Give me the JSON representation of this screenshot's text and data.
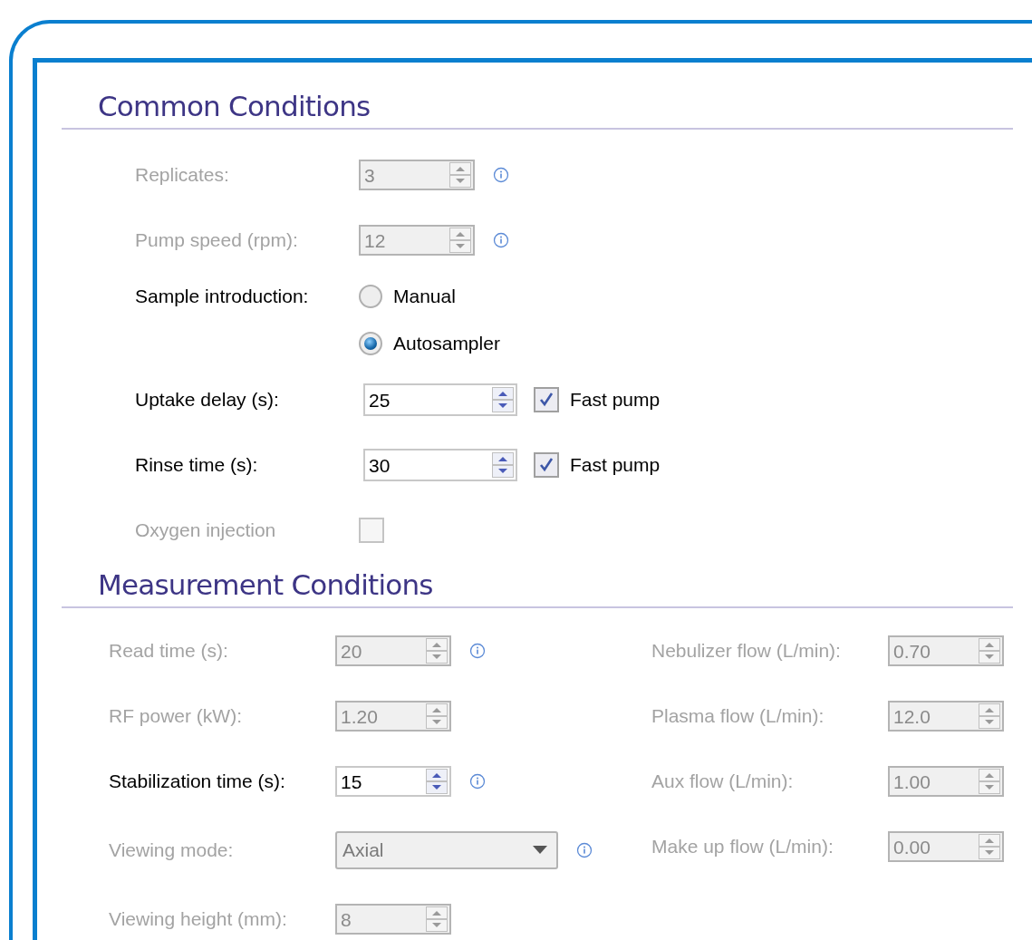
{
  "common": {
    "title": "Common Conditions",
    "rows": [
      {
        "kind": "spin",
        "label": "Replicates:",
        "value": "3",
        "disabled": true,
        "info": true
      },
      {
        "kind": "spin",
        "label": "Pump speed (rpm):",
        "value": "12",
        "disabled": true,
        "info": true
      },
      {
        "kind": "radio",
        "label": "Sample introduction:",
        "disabled": false,
        "options": [
          {
            "label": "Manual",
            "selected": false
          },
          {
            "label": "Autosampler",
            "selected": true
          }
        ]
      },
      {
        "kind": "spin",
        "label": "Uptake delay (s):",
        "value": "25",
        "disabled": false,
        "checkbox": {
          "label": "Fast pump",
          "checked": true
        }
      },
      {
        "kind": "spin",
        "label": "Rinse time (s):",
        "value": "30",
        "disabled": false,
        "checkbox": {
          "label": "Fast pump",
          "checked": true
        }
      },
      {
        "kind": "check",
        "label": "Oxygen injection",
        "disabled": true,
        "checked": false
      }
    ]
  },
  "measurement": {
    "title": "Measurement Conditions",
    "columns": [
      [
        {
          "kind": "spin",
          "label": "Read time (s):",
          "value": "20",
          "disabled": true,
          "info": true
        },
        {
          "kind": "spin",
          "label": "RF power (kW):",
          "value": "1.20",
          "disabled": true
        },
        {
          "kind": "spin",
          "label": "Stabilization time (s):",
          "value": "15",
          "disabled": false,
          "info": true
        },
        {
          "kind": "select",
          "label": "Viewing mode:",
          "value": "Axial",
          "disabled": true,
          "info": true
        },
        {
          "kind": "spin",
          "label": "Viewing height (mm):",
          "value": "8",
          "disabled": true
        }
      ],
      [
        {
          "kind": "spin",
          "label": "Nebulizer flow (L/min):",
          "value": "0.70",
          "disabled": true
        },
        {
          "kind": "spin",
          "label": "Plasma flow (L/min):",
          "value": "12.0",
          "disabled": true
        },
        {
          "kind": "spin",
          "label": "Aux flow (L/min):",
          "value": "1.00",
          "disabled": true
        },
        {
          "kind": "spin",
          "label": "Make up flow (L/min):",
          "value": "0.00",
          "disabled": true
        }
      ]
    ]
  }
}
